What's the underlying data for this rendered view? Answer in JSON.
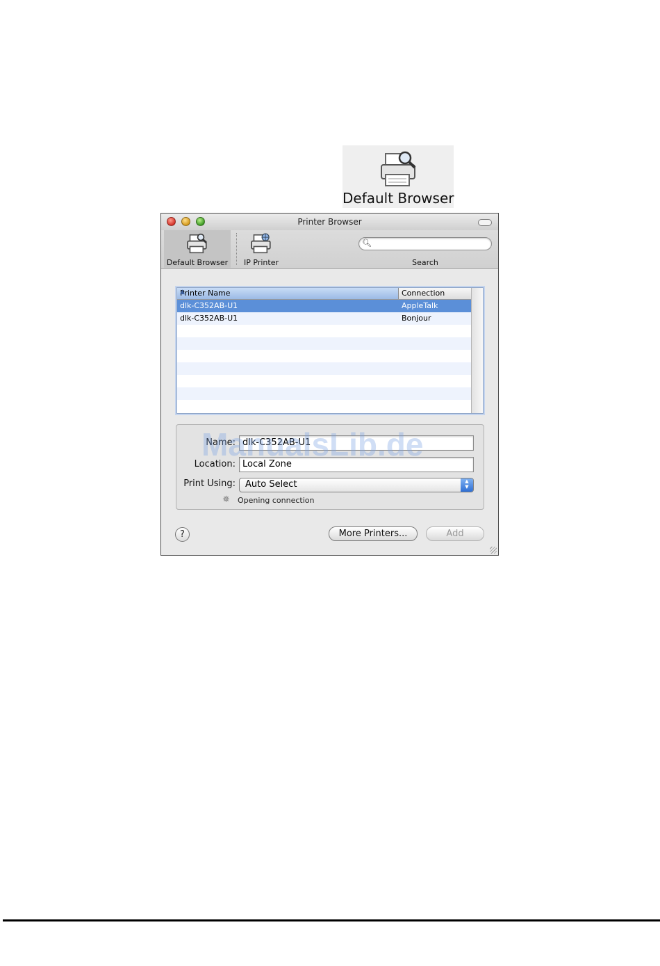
{
  "zoomed_item": {
    "label": "Default Browser",
    "icon": "printer-magnifier-icon"
  },
  "window": {
    "title": "Printer Browser",
    "toolbar": {
      "default_browser_label": "Default Browser",
      "ip_printer_label": "IP Printer",
      "search_label": "Search",
      "search_value": ""
    },
    "table": {
      "columns": [
        "Printer Name",
        "Connection"
      ],
      "rows": [
        {
          "name": "dlk-C352AB-U1",
          "connection": "AppleTalk",
          "selected": true
        },
        {
          "name": "dlk-C352AB-U1",
          "connection": "Bonjour",
          "selected": false
        }
      ]
    },
    "details": {
      "name_label": "Name:",
      "name_value": "dlk-C352AB-U1",
      "location_label": "Location:",
      "location_value": "Local Zone",
      "print_using_label": "Print Using:",
      "print_using_value": "Auto Select",
      "status": "Opening connection"
    },
    "buttons": {
      "help": "?",
      "more_printers": "More Printers...",
      "add": "Add"
    }
  },
  "watermark": "ManualsLib.de",
  "colors": {
    "selection": "#5b8fd8",
    "accent": "#2f6fd4"
  }
}
